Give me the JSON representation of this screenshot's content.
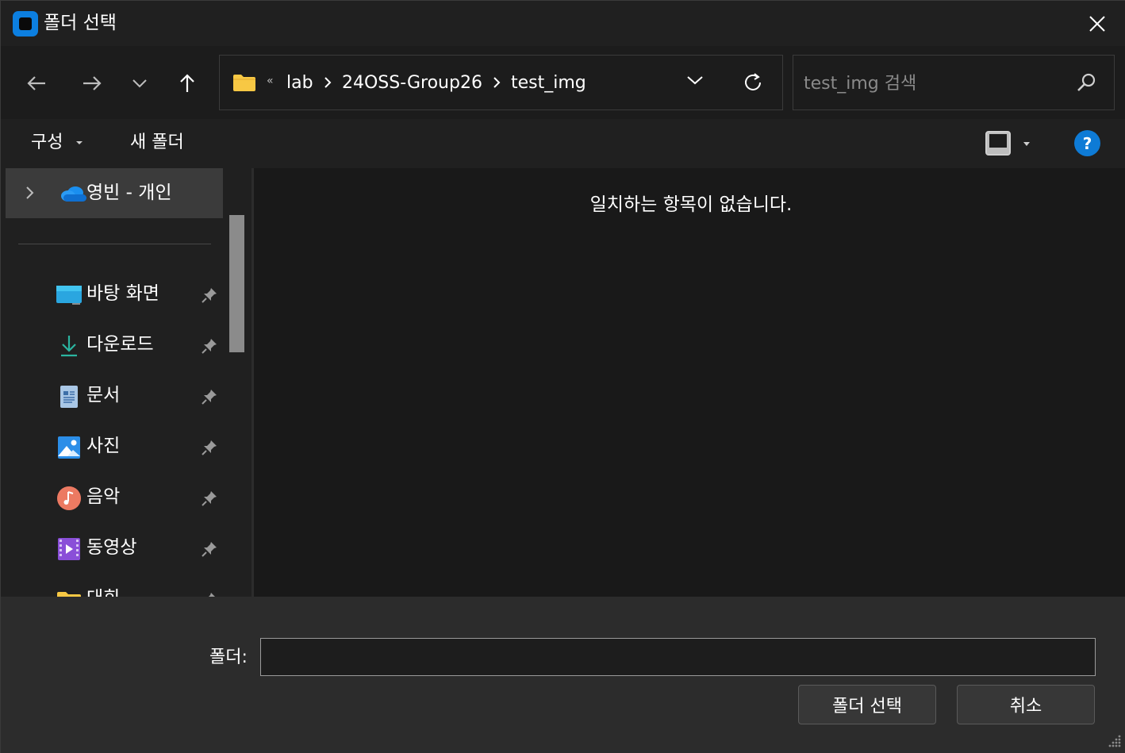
{
  "window": {
    "title": "폴더 선택"
  },
  "address_bar": {
    "overflow": "«",
    "crumbs": [
      "lab",
      "24OSS-Group26",
      "test_img"
    ]
  },
  "search": {
    "placeholder": "test_img 검색"
  },
  "command_bar": {
    "organize_label": "구성",
    "new_folder_label": "새 폴더"
  },
  "nav_pane": {
    "onedrive_label": "영빈 - 개인",
    "quick_access": [
      {
        "label": "바탕 화면",
        "icon": "desktop-icon"
      },
      {
        "label": "다운로드",
        "icon": "download-icon"
      },
      {
        "label": "문서",
        "icon": "documents-icon"
      },
      {
        "label": "사진",
        "icon": "pictures-icon"
      },
      {
        "label": "음악",
        "icon": "music-icon"
      },
      {
        "label": "동영상",
        "icon": "videos-icon"
      },
      {
        "label": "대회",
        "icon": "folder-icon"
      }
    ]
  },
  "content": {
    "empty_message": "일치하는 항목이 없습니다."
  },
  "footer": {
    "folder_label": "폴더:",
    "folder_value": "",
    "select_button": "폴더 선택",
    "cancel_button": "취소"
  },
  "colors": {
    "accent": "#0e7bd6",
    "folder": "#f7c844",
    "background": "#202020"
  }
}
